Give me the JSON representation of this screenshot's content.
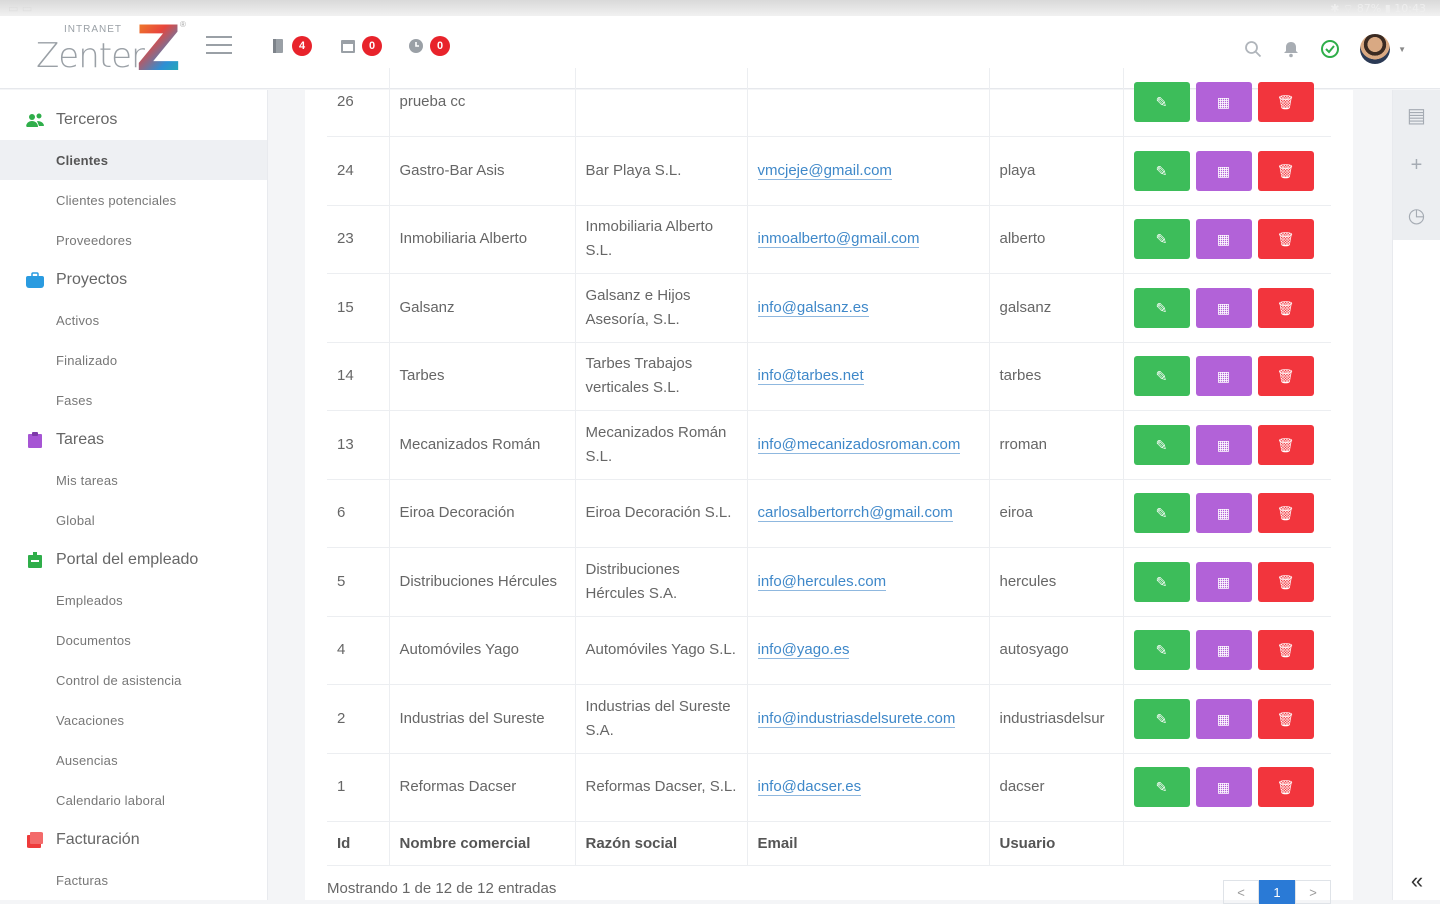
{
  "statusbar": {
    "left": "▭ ▭",
    "right": "✱ ⌔ 87% ▮ 10:43"
  },
  "header": {
    "logo_intranet": "INTRANET",
    "logo_text": "Zenter",
    "logo_z": "Z",
    "logo_reg": "®",
    "notifications": [
      {
        "icon": "book-icon",
        "count": "4"
      },
      {
        "icon": "calendar-icon",
        "count": "0"
      },
      {
        "icon": "clock-icon",
        "count": "0"
      }
    ]
  },
  "sidebar": {
    "groups": [
      {
        "label": "Terceros",
        "icon": "users-icon",
        "color": "#2fae4a",
        "items": [
          {
            "label": "Clientes",
            "active": true
          },
          {
            "label": "Clientes potenciales"
          },
          {
            "label": "Proveedores"
          }
        ]
      },
      {
        "label": "Proyectos",
        "icon": "briefcase-icon",
        "color": "#2a9be0",
        "items": [
          {
            "label": "Activos"
          },
          {
            "label": "Finalizado"
          },
          {
            "label": "Fases"
          }
        ]
      },
      {
        "label": "Tareas",
        "icon": "clipboard-icon",
        "color": "#a655d4",
        "items": [
          {
            "label": "Mis tareas"
          },
          {
            "label": "Global"
          }
        ]
      },
      {
        "label": "Portal del empleado",
        "icon": "id-badge-icon",
        "color": "#2fae4a",
        "items": [
          {
            "label": "Empleados"
          },
          {
            "label": "Documentos"
          },
          {
            "label": "Control de asistencia"
          },
          {
            "label": "Vacaciones"
          },
          {
            "label": "Ausencias"
          },
          {
            "label": "Calendario laboral"
          }
        ]
      },
      {
        "label": "Facturación",
        "icon": "invoice-icon",
        "color": "#ee3b3b",
        "items": [
          {
            "label": "Facturas"
          }
        ]
      }
    ]
  },
  "table": {
    "rows": [
      {
        "id": "26",
        "nombre": "prueba cc",
        "razon": "",
        "email": "",
        "usuario": ""
      },
      {
        "id": "24",
        "nombre": "Gastro-Bar Asis",
        "razon": "Bar Playa S.L.",
        "email": "vmcjeje@gmail.com",
        "usuario": "playa"
      },
      {
        "id": "23",
        "nombre": "Inmobiliaria Alberto",
        "razon": "Inmobiliaria Alberto S.L.",
        "email": "inmoalberto@gmail.com",
        "usuario": "alberto"
      },
      {
        "id": "15",
        "nombre": "Galsanz",
        "razon": "Galsanz e Hijos Asesoría, S.L.",
        "email": "info@galsanz.es",
        "usuario": "galsanz"
      },
      {
        "id": "14",
        "nombre": "Tarbes",
        "razon": "Tarbes Trabajos verticales S.L.",
        "email": "info@tarbes.net",
        "usuario": "tarbes"
      },
      {
        "id": "13",
        "nombre": "Mecanizados Román",
        "razon": "Mecanizados Román S.L.",
        "email": "info@mecanizadosroman.com",
        "usuario": "rroman"
      },
      {
        "id": "6",
        "nombre": "Eiroa Decoración",
        "razon": "Eiroa Decoración S.L.",
        "email": "carlosalbertorrch@gmail.com",
        "usuario": "eiroa"
      },
      {
        "id": "5",
        "nombre": "Distribuciones Hércules",
        "razon": "Distribuciones Hércules S.A.",
        "email": "info@hercules.com",
        "usuario": "hercules"
      },
      {
        "id": "4",
        "nombre": "Automóviles Yago",
        "razon": "Automóviles Yago S.L.",
        "email": "info@yago.es",
        "usuario": "autosyago"
      },
      {
        "id": "2",
        "nombre": "Industrias del Sureste",
        "razon": "Industrias del Sureste S.A.",
        "email": "info@industriasdelsurete.com",
        "usuario": "industriasdelsur"
      },
      {
        "id": "1",
        "nombre": "Reformas Dacser",
        "razon": "Reformas Dacser, S.L.",
        "email": "info@dacser.es",
        "usuario": "dacser"
      }
    ],
    "footer": {
      "id": "Id",
      "nombre": "Nombre comercial",
      "razon": "Razón social",
      "email": "Email",
      "usuario": "Usuario"
    },
    "buttons": {
      "edit": "✎",
      "calendar": "▦",
      "delete": "🗑"
    }
  },
  "showing": "Mostrando 1 de 12 de 12 entradas",
  "pager": {
    "prev": "<",
    "current": "1",
    "next": ">"
  },
  "rail": {
    "collapse": "«"
  }
}
